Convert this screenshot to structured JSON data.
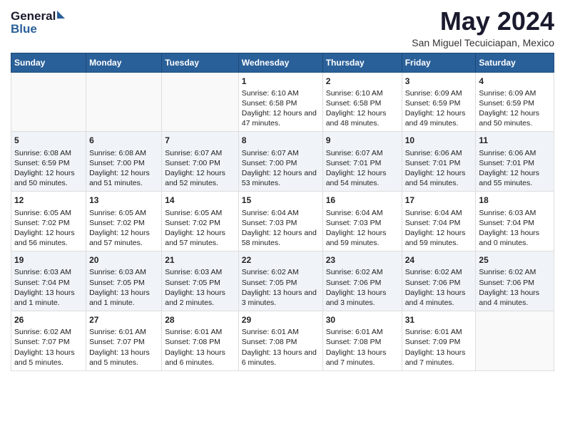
{
  "logo": {
    "line1": "General",
    "line2": "Blue"
  },
  "title": "May 2024",
  "subtitle": "San Miguel Tecuiciapan, Mexico",
  "days_header": [
    "Sunday",
    "Monday",
    "Tuesday",
    "Wednesday",
    "Thursday",
    "Friday",
    "Saturday"
  ],
  "weeks": [
    [
      {
        "day": "",
        "text": ""
      },
      {
        "day": "",
        "text": ""
      },
      {
        "day": "",
        "text": ""
      },
      {
        "day": "1",
        "text": "Sunrise: 6:10 AM\nSunset: 6:58 PM\nDaylight: 12 hours and 47 minutes."
      },
      {
        "day": "2",
        "text": "Sunrise: 6:10 AM\nSunset: 6:58 PM\nDaylight: 12 hours and 48 minutes."
      },
      {
        "day": "3",
        "text": "Sunrise: 6:09 AM\nSunset: 6:59 PM\nDaylight: 12 hours and 49 minutes."
      },
      {
        "day": "4",
        "text": "Sunrise: 6:09 AM\nSunset: 6:59 PM\nDaylight: 12 hours and 50 minutes."
      }
    ],
    [
      {
        "day": "5",
        "text": "Sunrise: 6:08 AM\nSunset: 6:59 PM\nDaylight: 12 hours and 50 minutes."
      },
      {
        "day": "6",
        "text": "Sunrise: 6:08 AM\nSunset: 7:00 PM\nDaylight: 12 hours and 51 minutes."
      },
      {
        "day": "7",
        "text": "Sunrise: 6:07 AM\nSunset: 7:00 PM\nDaylight: 12 hours and 52 minutes."
      },
      {
        "day": "8",
        "text": "Sunrise: 6:07 AM\nSunset: 7:00 PM\nDaylight: 12 hours and 53 minutes."
      },
      {
        "day": "9",
        "text": "Sunrise: 6:07 AM\nSunset: 7:01 PM\nDaylight: 12 hours and 54 minutes."
      },
      {
        "day": "10",
        "text": "Sunrise: 6:06 AM\nSunset: 7:01 PM\nDaylight: 12 hours and 54 minutes."
      },
      {
        "day": "11",
        "text": "Sunrise: 6:06 AM\nSunset: 7:01 PM\nDaylight: 12 hours and 55 minutes."
      }
    ],
    [
      {
        "day": "12",
        "text": "Sunrise: 6:05 AM\nSunset: 7:02 PM\nDaylight: 12 hours and 56 minutes."
      },
      {
        "day": "13",
        "text": "Sunrise: 6:05 AM\nSunset: 7:02 PM\nDaylight: 12 hours and 57 minutes."
      },
      {
        "day": "14",
        "text": "Sunrise: 6:05 AM\nSunset: 7:02 PM\nDaylight: 12 hours and 57 minutes."
      },
      {
        "day": "15",
        "text": "Sunrise: 6:04 AM\nSunset: 7:03 PM\nDaylight: 12 hours and 58 minutes."
      },
      {
        "day": "16",
        "text": "Sunrise: 6:04 AM\nSunset: 7:03 PM\nDaylight: 12 hours and 59 minutes."
      },
      {
        "day": "17",
        "text": "Sunrise: 6:04 AM\nSunset: 7:04 PM\nDaylight: 12 hours and 59 minutes."
      },
      {
        "day": "18",
        "text": "Sunrise: 6:03 AM\nSunset: 7:04 PM\nDaylight: 13 hours and 0 minutes."
      }
    ],
    [
      {
        "day": "19",
        "text": "Sunrise: 6:03 AM\nSunset: 7:04 PM\nDaylight: 13 hours and 1 minute."
      },
      {
        "day": "20",
        "text": "Sunrise: 6:03 AM\nSunset: 7:05 PM\nDaylight: 13 hours and 1 minute."
      },
      {
        "day": "21",
        "text": "Sunrise: 6:03 AM\nSunset: 7:05 PM\nDaylight: 13 hours and 2 minutes."
      },
      {
        "day": "22",
        "text": "Sunrise: 6:02 AM\nSunset: 7:05 PM\nDaylight: 13 hours and 3 minutes."
      },
      {
        "day": "23",
        "text": "Sunrise: 6:02 AM\nSunset: 7:06 PM\nDaylight: 13 hours and 3 minutes."
      },
      {
        "day": "24",
        "text": "Sunrise: 6:02 AM\nSunset: 7:06 PM\nDaylight: 13 hours and 4 minutes."
      },
      {
        "day": "25",
        "text": "Sunrise: 6:02 AM\nSunset: 7:06 PM\nDaylight: 13 hours and 4 minutes."
      }
    ],
    [
      {
        "day": "26",
        "text": "Sunrise: 6:02 AM\nSunset: 7:07 PM\nDaylight: 13 hours and 5 minutes."
      },
      {
        "day": "27",
        "text": "Sunrise: 6:01 AM\nSunset: 7:07 PM\nDaylight: 13 hours and 5 minutes."
      },
      {
        "day": "28",
        "text": "Sunrise: 6:01 AM\nSunset: 7:08 PM\nDaylight: 13 hours and 6 minutes."
      },
      {
        "day": "29",
        "text": "Sunrise: 6:01 AM\nSunset: 7:08 PM\nDaylight: 13 hours and 6 minutes."
      },
      {
        "day": "30",
        "text": "Sunrise: 6:01 AM\nSunset: 7:08 PM\nDaylight: 13 hours and 7 minutes."
      },
      {
        "day": "31",
        "text": "Sunrise: 6:01 AM\nSunset: 7:09 PM\nDaylight: 13 hours and 7 minutes."
      },
      {
        "day": "",
        "text": ""
      }
    ]
  ]
}
